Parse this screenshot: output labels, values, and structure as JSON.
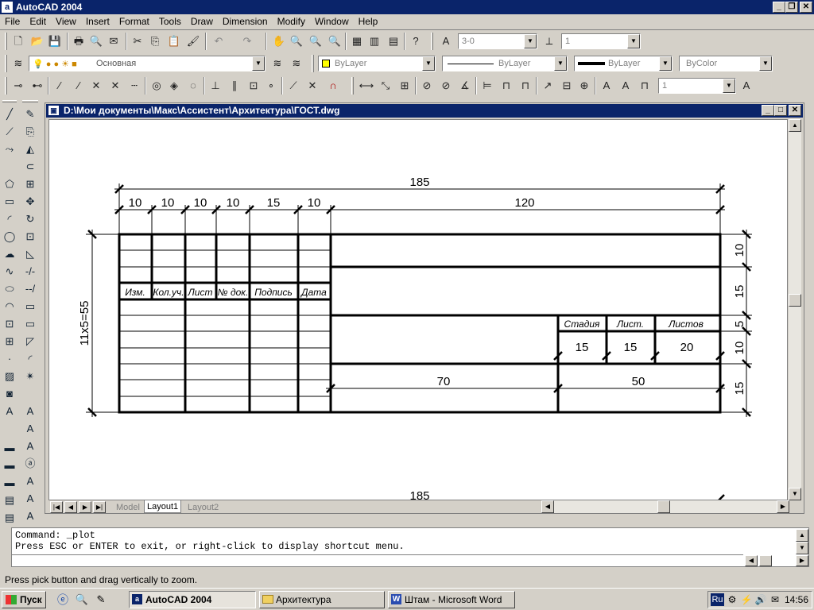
{
  "app": {
    "title": "AutoCAD 2004"
  },
  "menu": [
    "File",
    "Edit",
    "View",
    "Insert",
    "Format",
    "Tools",
    "Draw",
    "Dimension",
    "Modify",
    "Window",
    "Help"
  ],
  "toolbar": {
    "style_combo": "3-0",
    "dim_combo": "1",
    "layer_combo": "Основная",
    "color_combo": "ByLayer",
    "linetype_combo": "ByLayer",
    "lineweight_combo": "ByLayer",
    "plotstyle_combo": "ByColor",
    "dimstyle_combo": "1"
  },
  "drawing": {
    "title": "D:\\Мои документы\\Макс\\Ассистент\\Архитектура\\ГОСТ.dwg",
    "tabs": [
      "Model",
      "Layout1",
      "Layout2"
    ],
    "active_tab": "Layout1",
    "dims": {
      "total": "185",
      "c1": "10",
      "c2": "10",
      "c3": "10",
      "c4": "10",
      "c5": "15",
      "c6": "10",
      "c7": "120",
      "left": "11x5=55",
      "r1": "10",
      "r2": "15",
      "r3": "5",
      "r4": "10",
      "r5": "15",
      "b1": "70",
      "b2": "50",
      "bottom": "185"
    },
    "labels": {
      "izm": "Изм.",
      "kol": "Кол.уч.",
      "list": "Лист",
      "nodok": "№ док.",
      "podpis": "Подпись",
      "data": "Дата",
      "stadia": "Стадия",
      "list2": "Лист.",
      "listov": "Листов",
      "v15a": "15",
      "v15b": "15",
      "v20": "20"
    }
  },
  "command": {
    "line1": "Command: _plot",
    "line2": "Press ESC or ENTER to exit, or right-click to display shortcut menu."
  },
  "status": {
    "text": "Press pick button and drag vertically to zoom."
  },
  "taskbar": {
    "start": "Пуск",
    "tasks": [
      "AutoCAD 2004",
      "Архитектура",
      "Штам - Microsoft Word"
    ],
    "lang": "Ru",
    "clock": "14:56"
  }
}
